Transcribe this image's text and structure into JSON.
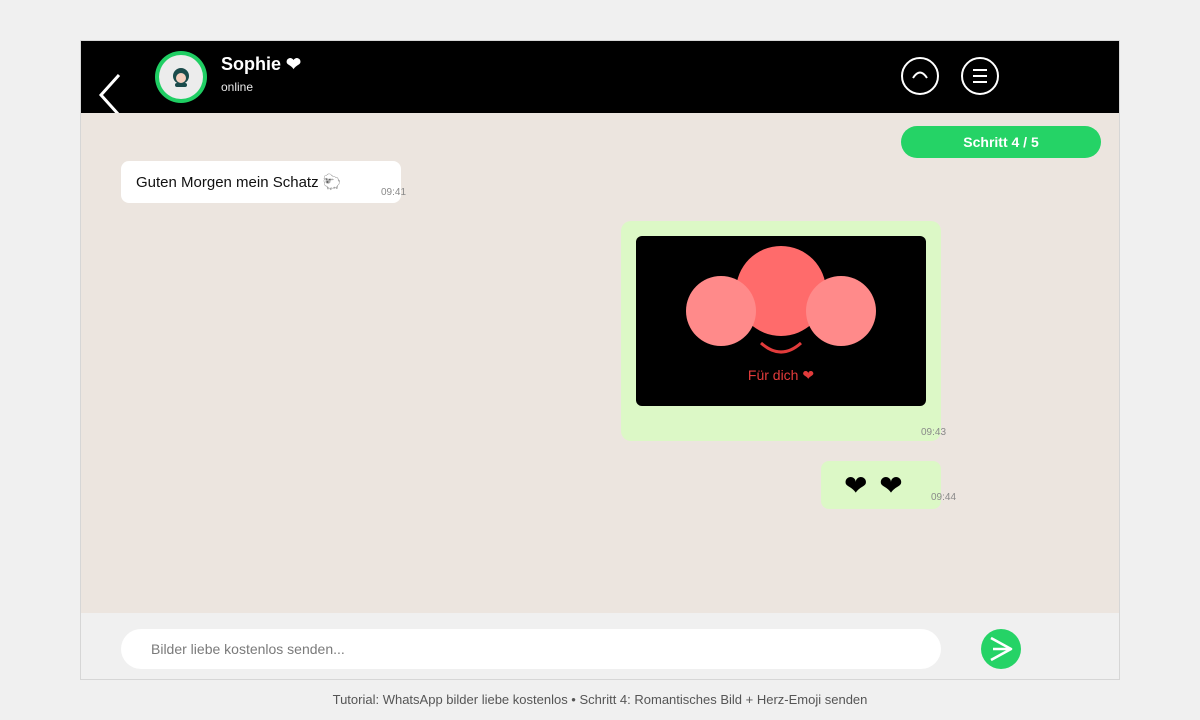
{
  "header": {
    "contact_name": "Sophie ❤",
    "status": "online",
    "icons": [
      "back-arrow-icon",
      "avatar-icon",
      "arc-icon",
      "menu-icon"
    ]
  },
  "step_badge": "Schritt 4 / 5",
  "messages": [
    {
      "direction": "incoming",
      "text": "Guten Morgen mein Schatz 🐑",
      "time": "09:41"
    },
    {
      "direction": "outgoing",
      "type": "image",
      "caption": "Für dich ❤",
      "time": "09:43"
    },
    {
      "direction": "outgoing",
      "text": "❤ ❤",
      "time": "09:44"
    }
  ],
  "composer": {
    "placeholder": "Bilder liebe kostenlos senden...",
    "send_icon": "send-icon"
  },
  "page_caption": "Tutorial: WhatsApp bilder liebe kostenlos • Schritt 4: Romantisches Bild + Herz-Emoji senden",
  "colors": {
    "header_bg": "#000000",
    "accent_green": "#25d366",
    "chat_bg": "#ece5df",
    "outgoing_bubble": "#dcf8c6",
    "incoming_bubble": "#ffffff",
    "heart_red": "#e23b3b"
  }
}
